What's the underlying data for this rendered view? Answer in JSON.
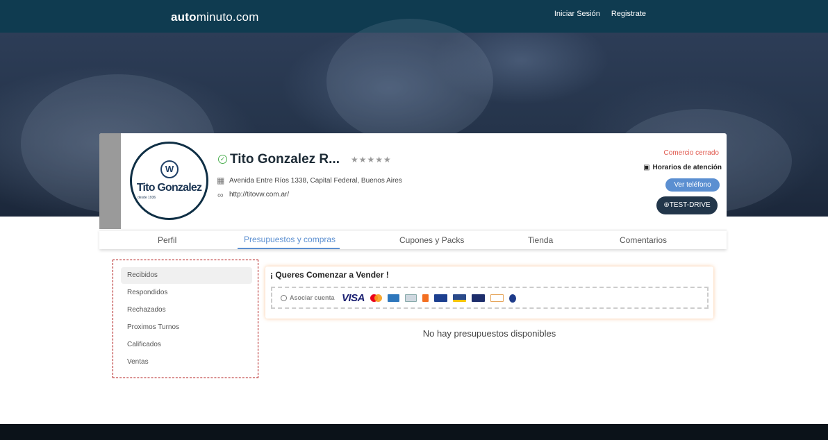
{
  "header": {
    "logo_bold": "auto",
    "logo_rest": "minuto.com",
    "nav": [
      "Iniciar Sesión",
      "Registrate"
    ]
  },
  "profile": {
    "avatar_name": "Tito Gonzalez",
    "avatar_sub": "desde 1936",
    "avatar_brand_icon": "vw",
    "name": "Tito Gonzalez R...",
    "rating_stars": 5,
    "stars_display": "★★★★★",
    "address": "Avenida Entre Ríos 1338, Capital Federal, Buenos Aires",
    "website": "http://titovw.com.ar/",
    "status": "Comercio cerrado",
    "hours_label": "Horarios de atención",
    "phone_button": "Ver teléfono",
    "test_drive_button": "TEST-DRIVE"
  },
  "tabs": [
    {
      "label": "Perfil"
    },
    {
      "label": "Presupuestos y compras"
    },
    {
      "label": "Cupones y Packs"
    },
    {
      "label": "Tienda"
    },
    {
      "label": "Comentarios"
    }
  ],
  "active_tab": "Presupuestos y compras",
  "sidebar": {
    "items": [
      {
        "label": "Recibidos"
      },
      {
        "label": "Respondidos"
      },
      {
        "label": "Rechazados"
      },
      {
        "label": "Proximos Turnos"
      },
      {
        "label": "Calificados"
      },
      {
        "label": "Ventas"
      }
    ],
    "active": "Recibidos"
  },
  "vender": {
    "title": "¡ Queres Comenzar a Vender !",
    "associate_label": "Asociar cuenta",
    "visa_text": "VISA",
    "payment_logos": [
      "visa",
      "mastercard",
      "amex",
      "diners",
      "naranja",
      "tarjeta-shopping",
      "nativa",
      "cabal",
      "cencosud",
      "argencard",
      "diners-club"
    ]
  },
  "empty_message": "No hay presupuestos disponibles",
  "colors": {
    "header": "#0f3b50",
    "accent": "#5b8fd1",
    "closed": "#e05a4f",
    "dark_button": "#22364a"
  }
}
